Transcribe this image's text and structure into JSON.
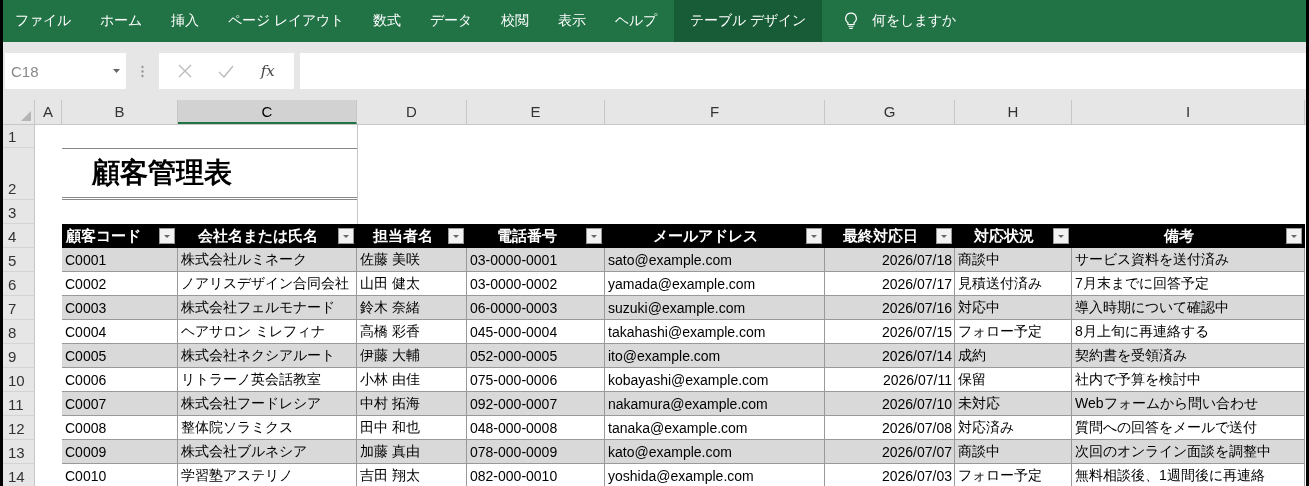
{
  "ribbon": {
    "tabs": [
      {
        "label": "ファイル",
        "selected": false
      },
      {
        "label": "ホーム",
        "selected": false
      },
      {
        "label": "挿入",
        "selected": false
      },
      {
        "label": "ページ レイアウト",
        "selected": false
      },
      {
        "label": "数式",
        "selected": false
      },
      {
        "label": "データ",
        "selected": false
      },
      {
        "label": "校閲",
        "selected": false
      },
      {
        "label": "表示",
        "selected": false
      },
      {
        "label": "ヘルプ",
        "selected": false
      },
      {
        "label": "テーブル デザイン",
        "selected": true
      }
    ],
    "tell_me": "何をしますか"
  },
  "formula_bar": {
    "name_box": "C18",
    "function_label": "fx"
  },
  "sheet": {
    "columns": [
      {
        "label": "A",
        "selected": false
      },
      {
        "label": "B",
        "selected": false
      },
      {
        "label": "C",
        "selected": true
      },
      {
        "label": "D",
        "selected": false
      },
      {
        "label": "E",
        "selected": false
      },
      {
        "label": "F",
        "selected": false
      },
      {
        "label": "G",
        "selected": false
      },
      {
        "label": "H",
        "selected": false
      },
      {
        "label": "I",
        "selected": false
      }
    ],
    "row_numbers": [
      "1",
      "2",
      "3",
      "4",
      "5",
      "6",
      "7",
      "8",
      "9",
      "10",
      "11",
      "12",
      "13",
      "14"
    ],
    "title": "顧客管理表",
    "table": {
      "columns": [
        "顧客コード",
        "会社名または氏名",
        "担当者名",
        "電話番号",
        "メールアドレス",
        "最終対応日",
        "対応状況",
        "備考"
      ],
      "rows": [
        [
          "C0001",
          "株式会社ルミネーク",
          "佐藤 美咲",
          "03-0000-0001",
          "sato@example.com",
          "2026/07/18",
          "商談中",
          "サービス資料を送付済み"
        ],
        [
          "C0002",
          "ノアリスデザイン合同会社",
          "山田 健太",
          "03-0000-0002",
          "yamada@example.com",
          "2026/07/17",
          "見積送付済み",
          "7月末までに回答予定"
        ],
        [
          "C0003",
          "株式会社フェルモナード",
          "鈴木 奈緒",
          "06-0000-0003",
          "suzuki@example.com",
          "2026/07/16",
          "対応中",
          "導入時期について確認中"
        ],
        [
          "C0004",
          "ヘアサロン ミレフィナ",
          "高橋 彩香",
          "045-000-0004",
          "takahashi@example.com",
          "2026/07/15",
          "フォロー予定",
          "8月上旬に再連絡する"
        ],
        [
          "C0005",
          "株式会社ネクシアルート",
          "伊藤 大輔",
          "052-000-0005",
          "ito@example.com",
          "2026/07/14",
          "成約",
          "契約書を受領済み"
        ],
        [
          "C0006",
          "リトラーノ英会話教室",
          "小林 由佳",
          "075-000-0006",
          "kobayashi@example.com",
          "2026/07/11",
          "保留",
          "社内で予算を検討中"
        ],
        [
          "C0007",
          "株式会社フードレシア",
          "中村 拓海",
          "092-000-0007",
          "nakamura@example.com",
          "2026/07/10",
          "未対応",
          "Webフォームから問い合わせ"
        ],
        [
          "C0008",
          "整体院ソラミクス",
          "田中 和也",
          "048-000-0008",
          "tanaka@example.com",
          "2026/07/08",
          "対応済み",
          "質問への回答をメールで送付"
        ],
        [
          "C0009",
          "株式会社ブルネシア",
          "加藤 真由",
          "078-000-0009",
          "kato@example.com",
          "2026/07/07",
          "商談中",
          "次回のオンライン面談を調整中"
        ],
        [
          "C0010",
          "学習塾アステリノ",
          "吉田 翔太",
          "082-000-0010",
          "yoshida@example.com",
          "2026/07/03",
          "フォロー予定",
          "無料相談後、1週間後に再連絡"
        ]
      ]
    }
  }
}
